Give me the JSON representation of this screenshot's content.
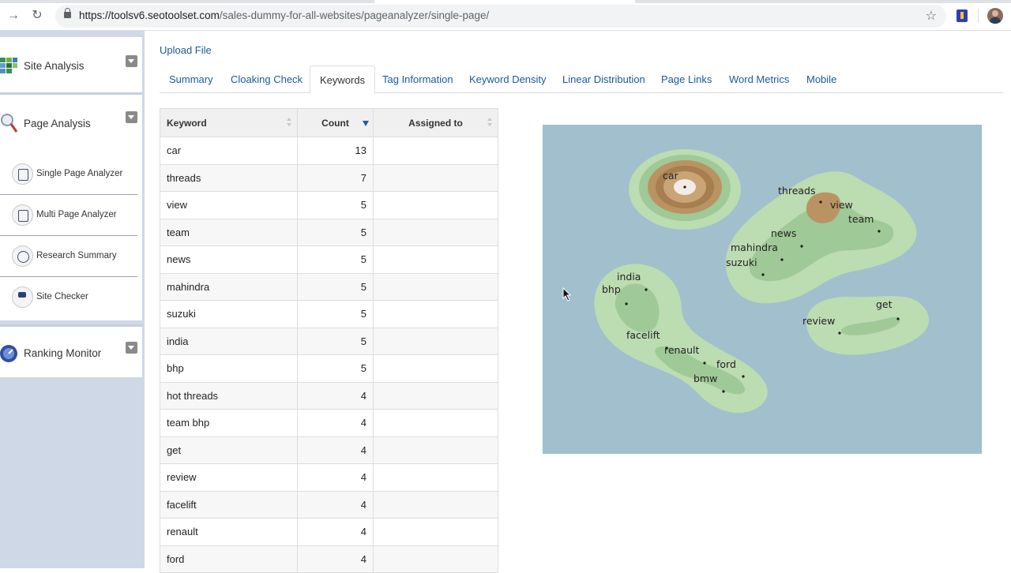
{
  "browser": {
    "url_host": "https://toolsv6.seotoolset.com",
    "url_path": "/sales-dummy-for-all-websites/pageanalyzer/single-page/"
  },
  "sidebar": {
    "sections": [
      {
        "label": "Site Analysis",
        "icon": "site-analysis-icon"
      },
      {
        "label": "Page Analysis",
        "icon": "magnifier-icon"
      },
      {
        "label": "Ranking Monitor",
        "icon": "ranking-monitor-icon"
      }
    ],
    "page_analysis_items": [
      {
        "label": "Single Page Analyzer",
        "icon": "code-page-icon"
      },
      {
        "label": "Multi Page Analyzer",
        "icon": "pages-icon"
      },
      {
        "label": "Research Summary",
        "icon": "target-icon"
      },
      {
        "label": "Site Checker",
        "icon": "flag-icon"
      }
    ]
  },
  "main": {
    "upload_label": "Upload File",
    "tabs": [
      {
        "label": "Summary"
      },
      {
        "label": "Cloaking Check"
      },
      {
        "label": "Keywords",
        "active": true
      },
      {
        "label": "Tag Information"
      },
      {
        "label": "Keyword Density"
      },
      {
        "label": "Linear Distribution"
      },
      {
        "label": "Page Links"
      },
      {
        "label": "Word Metrics"
      },
      {
        "label": "Mobile"
      }
    ],
    "table": {
      "headers": {
        "keyword": "Keyword",
        "count": "Count",
        "assigned": "Assigned to"
      },
      "rows": [
        {
          "keyword": "car",
          "count": "13",
          "assigned": ""
        },
        {
          "keyword": "threads",
          "count": "7",
          "assigned": ""
        },
        {
          "keyword": "view",
          "count": "5",
          "assigned": ""
        },
        {
          "keyword": "team",
          "count": "5",
          "assigned": ""
        },
        {
          "keyword": "news",
          "count": "5",
          "assigned": ""
        },
        {
          "keyword": "mahindra",
          "count": "5",
          "assigned": ""
        },
        {
          "keyword": "suzuki",
          "count": "5",
          "assigned": ""
        },
        {
          "keyword": "india",
          "count": "5",
          "assigned": ""
        },
        {
          "keyword": "bhp",
          "count": "5",
          "assigned": ""
        },
        {
          "keyword": "hot threads",
          "count": "4",
          "assigned": ""
        },
        {
          "keyword": "team bhp",
          "count": "4",
          "assigned": ""
        },
        {
          "keyword": "get",
          "count": "4",
          "assigned": ""
        },
        {
          "keyword": "review",
          "count": "4",
          "assigned": ""
        },
        {
          "keyword": "facelift",
          "count": "4",
          "assigned": ""
        },
        {
          "keyword": "renault",
          "count": "4",
          "assigned": ""
        },
        {
          "keyword": "ford",
          "count": "4",
          "assigned": ""
        }
      ]
    },
    "wordmap_labels": [
      "car",
      "threads",
      "view",
      "team",
      "news",
      "mahindra",
      "suzuki",
      "india",
      "bhp",
      "facelift",
      "renault",
      "ford",
      "bmw",
      "get",
      "review"
    ]
  },
  "colors": {
    "link": "#1a5a9c",
    "map_background": "#a1bfcc",
    "terrain_light": "#bcdcb2",
    "terrain_mid": "#9fc996",
    "terrain_brown": "#b99462"
  }
}
